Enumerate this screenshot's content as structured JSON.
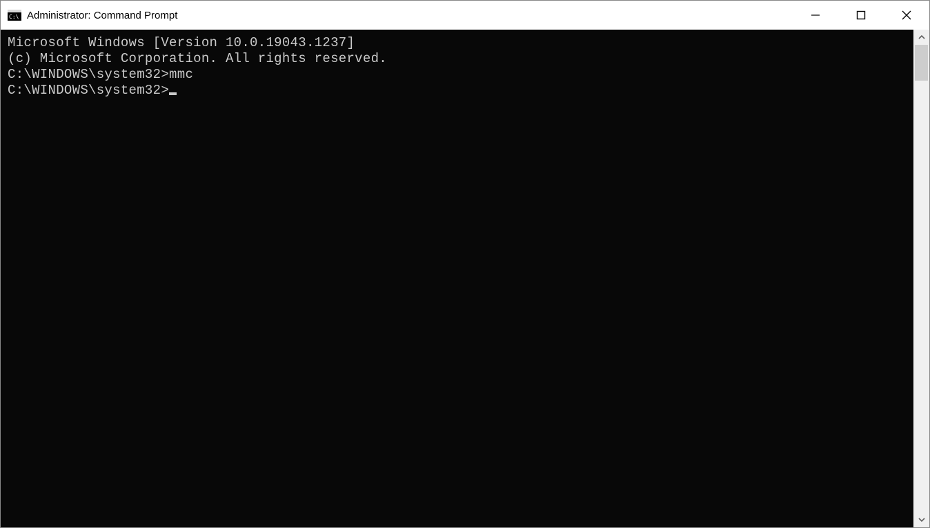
{
  "window": {
    "title": "Administrator: Command Prompt"
  },
  "terminal": {
    "line1": "Microsoft Windows [Version 10.0.19043.1237]",
    "line2": "(c) Microsoft Corporation. All rights reserved.",
    "blank1": "",
    "prompt1_path": "C:\\WINDOWS\\system32>",
    "prompt1_cmd": "mmc",
    "blank2": "",
    "prompt2_path": "C:\\WINDOWS\\system32>"
  }
}
